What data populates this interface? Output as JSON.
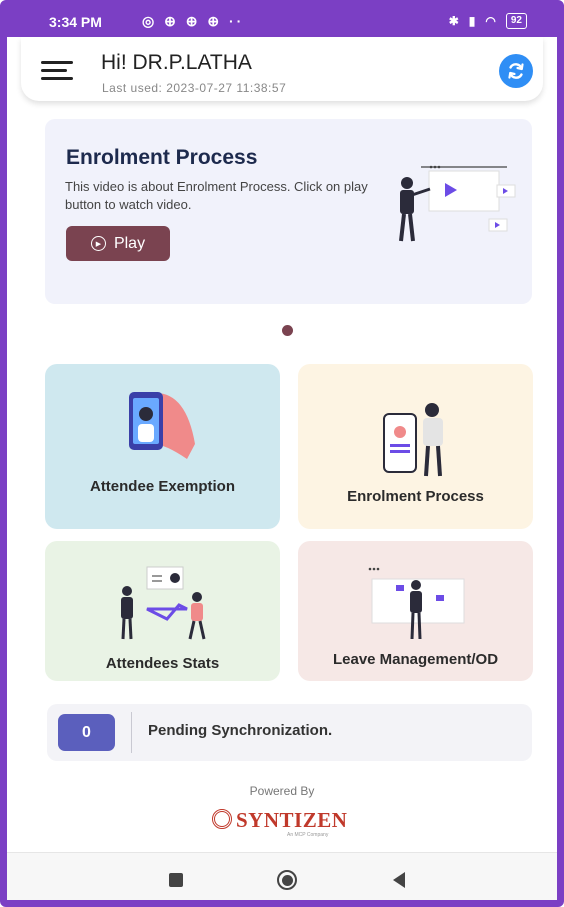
{
  "status_bar": {
    "time": "3:34 PM",
    "icons_text": "◎ ⊕ ⊕ ⊕ ··",
    "battery": "92"
  },
  "header": {
    "greeting": "Hi! DR.P.LATHA",
    "last_used": "Last used: 2023-07-27 11:38:57",
    "menu_icon": "hamburger-menu-icon",
    "sync_icon": "refresh-icon"
  },
  "banner": {
    "title": "Enrolment Process",
    "description": "This video is about Enrolment Process. Click on play button to watch video.",
    "play_label": "Play"
  },
  "tiles": [
    {
      "label": "Attendee Exemption",
      "color": "#cfe8ef"
    },
    {
      "label": "Enrolment Process",
      "color": "#fdf4e3"
    },
    {
      "label": "Attendees Stats",
      "color": "#e9f3e5"
    },
    {
      "label": "Leave Management/OD",
      "color": "#f6e8e6"
    }
  ],
  "pending": {
    "count": "0",
    "label": "Pending Synchronization."
  },
  "footer": {
    "powered_by": "Powered By",
    "brand": "SYNTIZEN",
    "brand_sub": "An MCP Company"
  },
  "colors": {
    "accent_purple": "#7b3fc4",
    "play_button": "#7a4350",
    "sync_blue": "#2f8ef5",
    "count_box": "#5b5fbd"
  }
}
